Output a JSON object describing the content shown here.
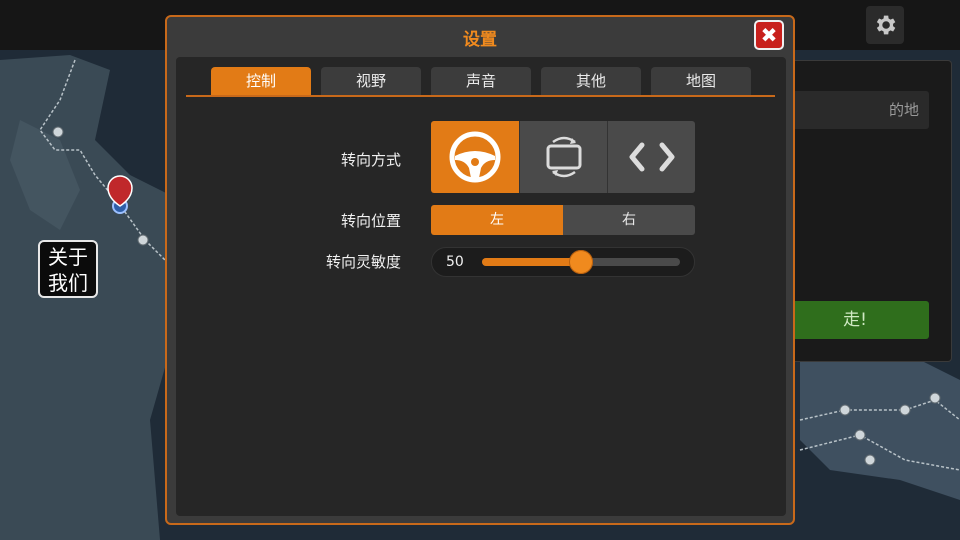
{
  "about": {
    "line1": "关于",
    "line2": "我们"
  },
  "right_panel": {
    "field_text": "的地",
    "go_label": "走!"
  },
  "dialog": {
    "title": "设置",
    "close_label": "✖",
    "tabs": [
      {
        "label": "控制",
        "active": true
      },
      {
        "label": "视野",
        "active": false
      },
      {
        "label": "声音",
        "active": false
      },
      {
        "label": "其他",
        "active": false
      },
      {
        "label": "地图",
        "active": false
      }
    ],
    "steering_mode": {
      "label": "转向方式",
      "options": [
        {
          "icon": "steering-wheel-icon",
          "active": true
        },
        {
          "icon": "tilt-device-icon",
          "active": false
        },
        {
          "icon": "arrow-buttons-icon",
          "active": false
        }
      ]
    },
    "steering_position": {
      "label": "转向位置",
      "options": [
        {
          "label": "左",
          "active": true
        },
        {
          "label": "右",
          "active": false
        }
      ]
    },
    "steering_sensitivity": {
      "label": "转向灵敏度",
      "value": "50",
      "fraction": 0.5
    }
  },
  "colors": {
    "accent": "#e27b16",
    "close": "#c8201c",
    "panel": "#262626"
  }
}
